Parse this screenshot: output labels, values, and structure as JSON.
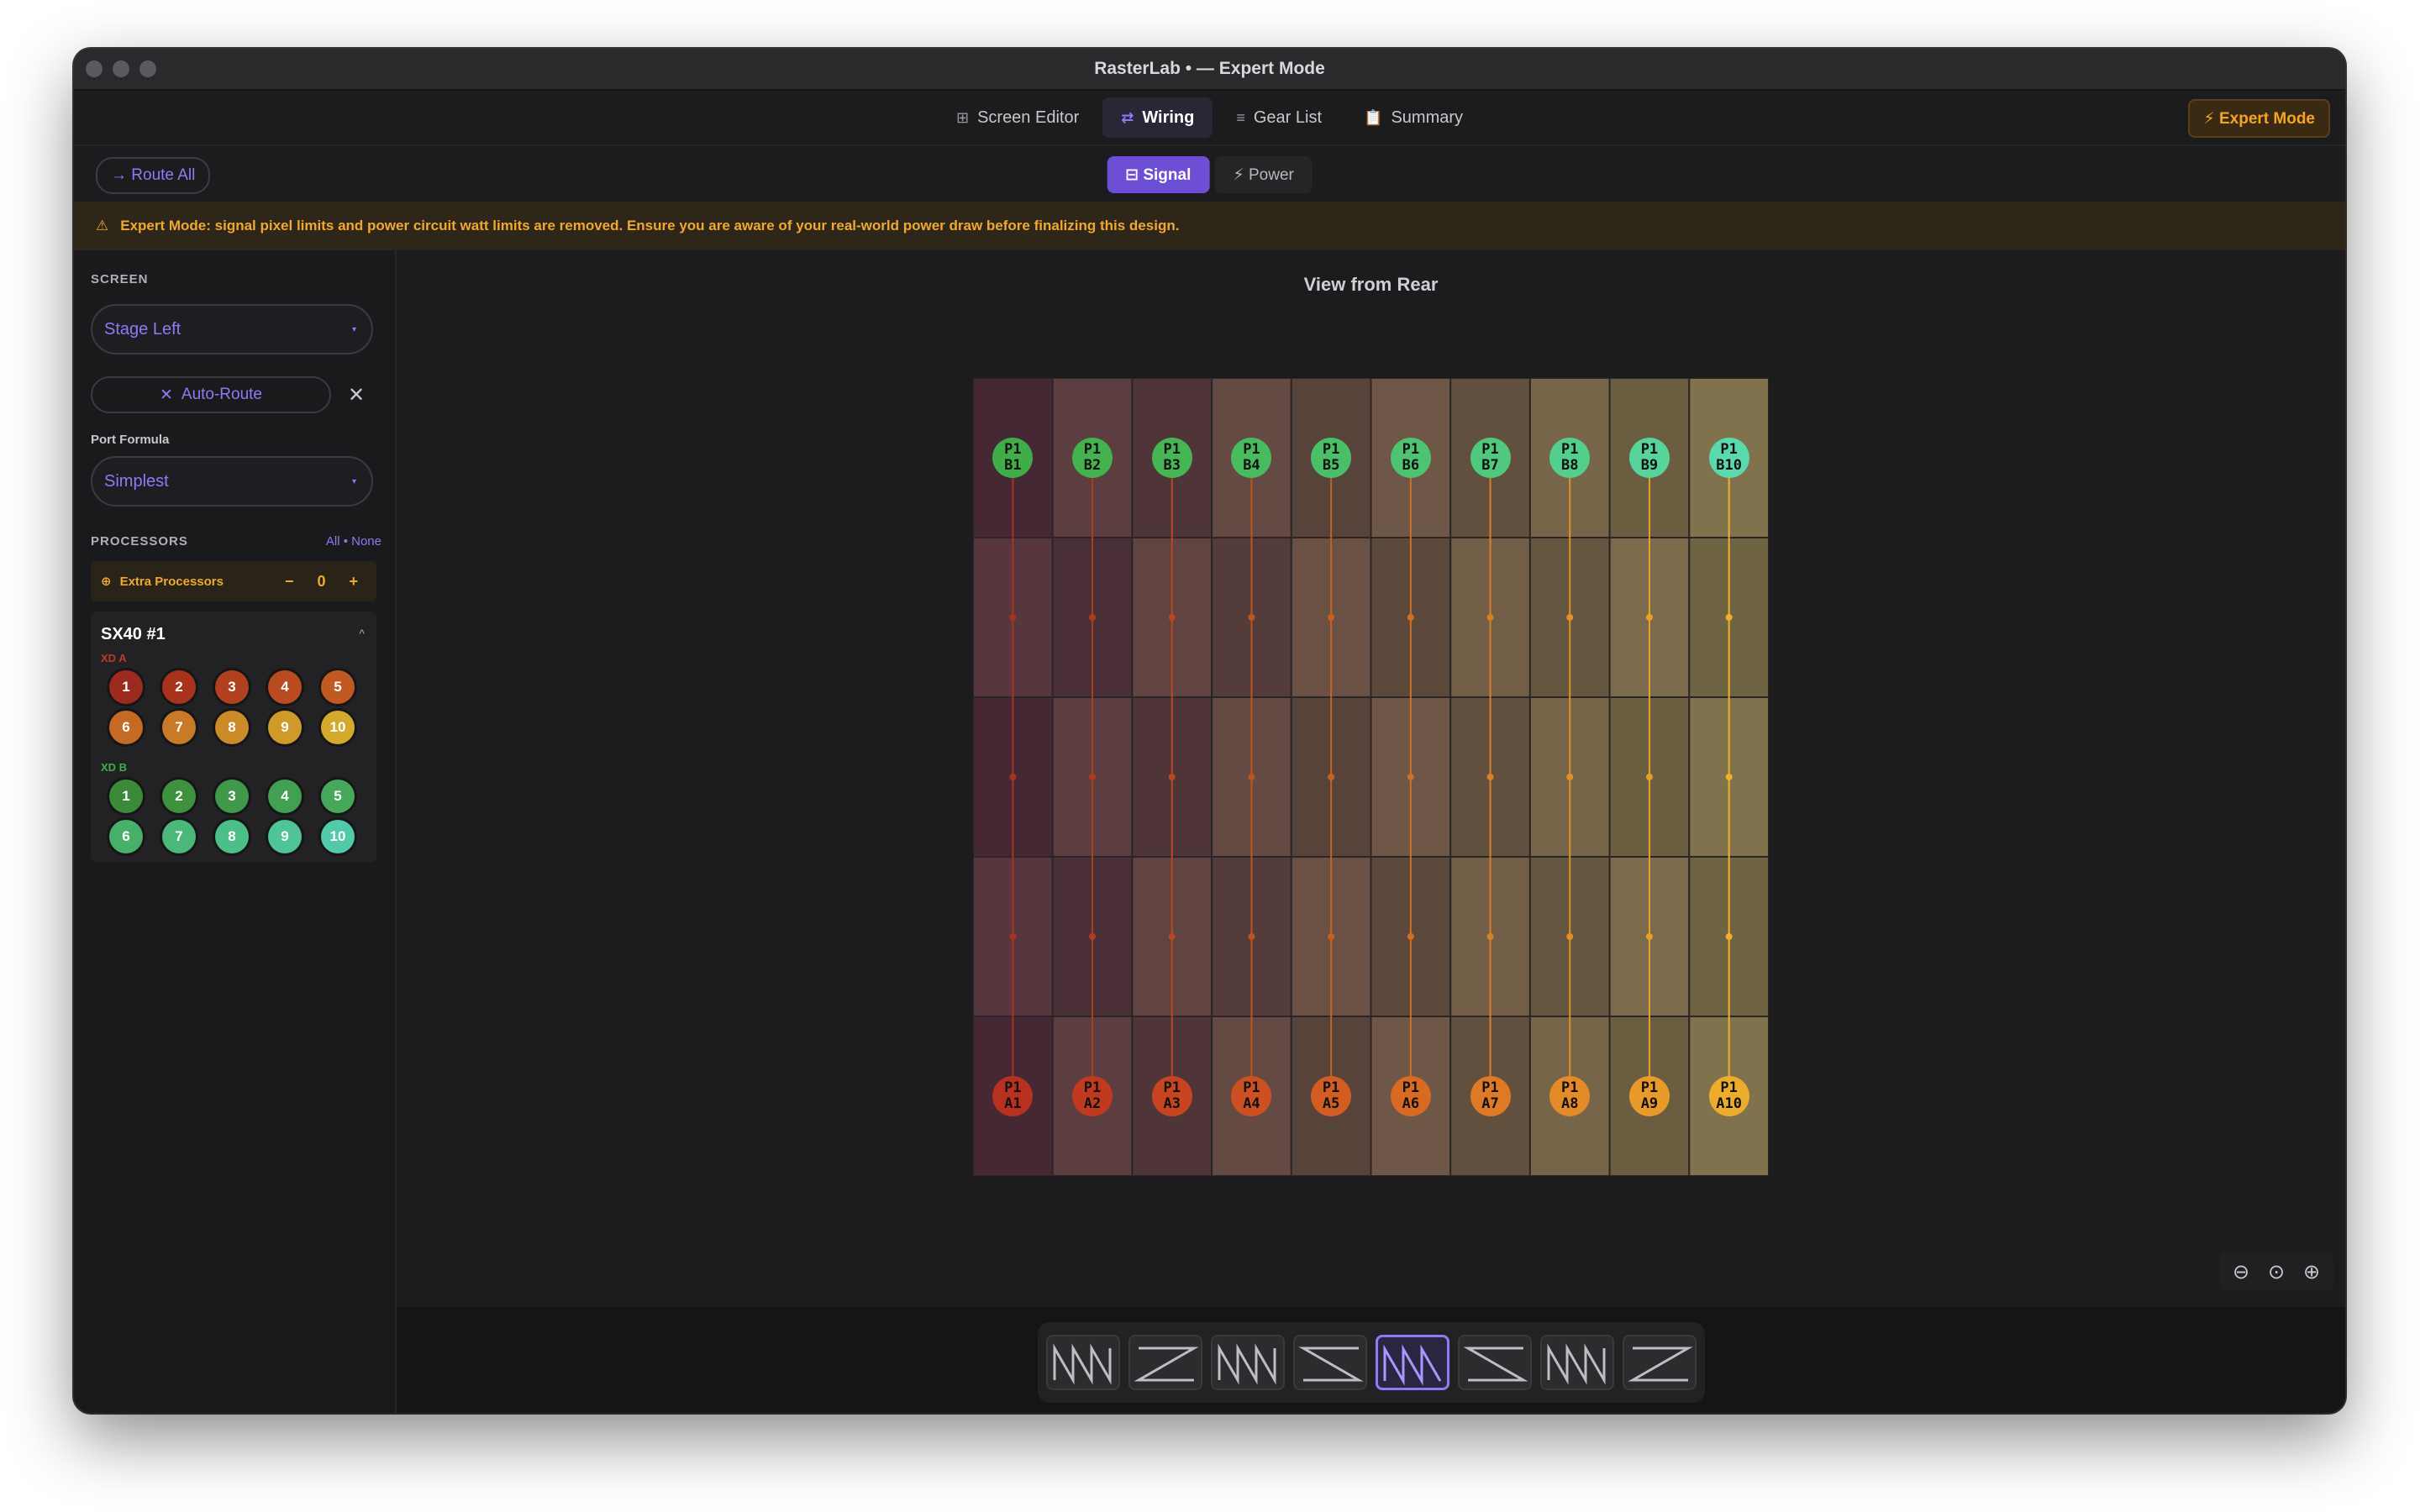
{
  "window": {
    "title": "RasterLab • — Expert Mode"
  },
  "tabs": [
    {
      "icon": "grid-icon",
      "glyph": "⊞",
      "label": "Screen Editor",
      "active": false
    },
    {
      "icon": "swap-icon",
      "glyph": "⇄",
      "label": "Wiring",
      "active": true
    },
    {
      "icon": "list-icon",
      "glyph": "≡",
      "label": "Gear List",
      "active": false
    },
    {
      "icon": "clipboard-icon",
      "glyph": "📋",
      "label": "Summary",
      "active": false
    }
  ],
  "expert_button": {
    "label": "⚡ Expert Mode"
  },
  "toolbar": {
    "route_all": "→ Route All",
    "signal": "⊟ Signal",
    "power": "⚡ Power",
    "active_mode": "Signal"
  },
  "banner": {
    "text": "Expert Mode: signal pixel limits and power circuit watt limits are removed. Ensure you are aware of your real-world power draw before finalizing this design."
  },
  "sidebar": {
    "screen_label": "SCREEN",
    "screen_value": "Stage Left",
    "auto_route": "Auto-Route",
    "port_formula_label": "Port Formula",
    "port_formula_value": "Simplest",
    "processors_label": "PROCESSORS",
    "all_none": "All • None",
    "extra_processors_label": "Extra Processors",
    "extra_processors_value": "0",
    "processor": {
      "name": "SX40 #1",
      "xd_a_label": "XD A",
      "xd_b_label": "XD B",
      "xd_a_ports": [
        "1",
        "2",
        "3",
        "4",
        "5",
        "6",
        "7",
        "8",
        "9",
        "10"
      ],
      "xd_b_ports": [
        "1",
        "2",
        "3",
        "4",
        "5",
        "6",
        "7",
        "8",
        "9",
        "10"
      ],
      "xd_a_colors": [
        "#9c2a1e",
        "#a8321c",
        "#b0401e",
        "#b84c20",
        "#c05a22",
        "#c46a24",
        "#c87a26",
        "#cc8a28",
        "#d09a2a",
        "#d4aa2c"
      ],
      "xd_b_colors": [
        "#3a8a3a",
        "#3e923e",
        "#40984a",
        "#42a052",
        "#46a85a",
        "#48b068",
        "#4ab878",
        "#4cbe88",
        "#4ec498",
        "#50caa8"
      ]
    }
  },
  "canvas": {
    "view_label": "View from Rear",
    "columns": 10,
    "rows": 5,
    "top_nodes": [
      {
        "l1": "P1",
        "l2": "B1",
        "color": "#3fae49"
      },
      {
        "l1": "P1",
        "l2": "B2",
        "color": "#44b24e"
      },
      {
        "l1": "P1",
        "l2": "B3",
        "color": "#46b655"
      },
      {
        "l1": "P1",
        "l2": "B4",
        "color": "#48bb5e"
      },
      {
        "l1": "P1",
        "l2": "B5",
        "color": "#4bbf68"
      },
      {
        "l1": "P1",
        "l2": "B6",
        "color": "#4ec472"
      },
      {
        "l1": "P1",
        "l2": "B7",
        "color": "#50c97e"
      },
      {
        "l1": "P1",
        "l2": "B8",
        "color": "#54ce8c"
      },
      {
        "l1": "P1",
        "l2": "B9",
        "color": "#57d39c"
      },
      {
        "l1": "P1",
        "l2": "B10",
        "color": "#5ad8ae"
      }
    ],
    "bottom_nodes": [
      {
        "l1": "P1",
        "l2": "A1",
        "color": "#b8301f"
      },
      {
        "l1": "P1",
        "l2": "A2",
        "color": "#c03a1f"
      },
      {
        "l1": "P1",
        "l2": "A3",
        "color": "#c64420"
      },
      {
        "l1": "P1",
        "l2": "A4",
        "color": "#cc5022"
      },
      {
        "l1": "P1",
        "l2": "A5",
        "color": "#d25c22"
      },
      {
        "l1": "P1",
        "l2": "A6",
        "color": "#d86a24"
      },
      {
        "l1": "P1",
        "l2": "A7",
        "color": "#de7a26"
      },
      {
        "l1": "P1",
        "l2": "A8",
        "color": "#e48a28"
      },
      {
        "l1": "P1",
        "l2": "A9",
        "color": "#e89a2a"
      },
      {
        "l1": "P1",
        "l2": "A10",
        "color": "#ecac2c"
      }
    ],
    "wire_colors": [
      "#a83420",
      "#b03c1e",
      "#b8481e",
      "#c05420",
      "#c86020",
      "#d07022",
      "#d88024",
      "#e09026",
      "#e8a028",
      "#f0b02a"
    ],
    "zoom": {
      "out": "⊖",
      "reset": "⊙",
      "in": "⊕"
    },
    "patterns": [
      "pattern-1",
      "pattern-2",
      "pattern-3",
      "pattern-4",
      "pattern-5",
      "pattern-6",
      "pattern-7",
      "pattern-8"
    ],
    "active_pattern": 4
  }
}
